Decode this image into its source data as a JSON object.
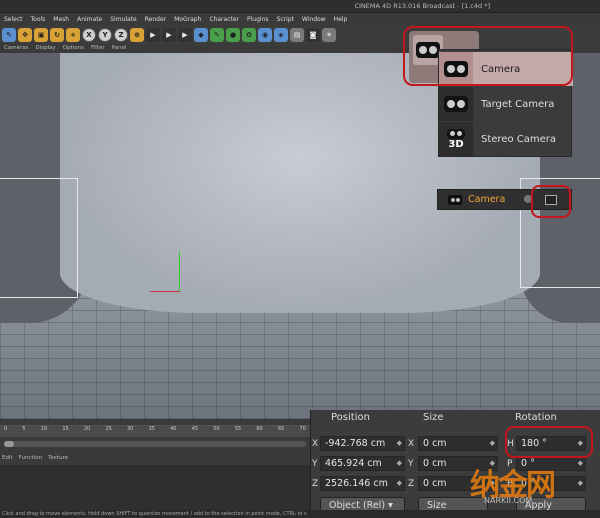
{
  "window": {
    "title": "CINEMA 4D R13.016 Broadcast - [1.c4d *]"
  },
  "menubar": [
    "Select",
    "Tools",
    "Mesh",
    "Animate",
    "Simulate",
    "Render",
    "MoGraph",
    "Character",
    "Plugins",
    "Script",
    "Window",
    "Help"
  ],
  "viewmenu": [
    "Cameras",
    "Display",
    "Options",
    "Filter",
    "Panel"
  ],
  "camera_menu": {
    "items": [
      {
        "label": "Camera",
        "icon": "camera-icon",
        "highlighted": true
      },
      {
        "label": "Target Camera",
        "icon": "target-camera-icon"
      },
      {
        "label": "Stereo Camera",
        "icon": "stereo-camera-icon",
        "badge": "3D"
      }
    ]
  },
  "object_manager": {
    "object_name": "Camera",
    "tag_icon": "target-tag-icon"
  },
  "timeline": {
    "ticks": [
      "0",
      "5",
      "10",
      "15",
      "20",
      "25",
      "30",
      "35",
      "40",
      "45",
      "50",
      "55",
      "60",
      "65",
      "70"
    ]
  },
  "material_menu": [
    "Edit",
    "Function",
    "Texture"
  ],
  "coordinates": {
    "headers": {
      "position": "Position",
      "size": "Size",
      "rotation": "Rotation"
    },
    "rows": [
      {
        "axis": "X",
        "position": "-942.768 cm",
        "size_axis": "X",
        "size": "0 cm",
        "rot_axis": "H",
        "rotation": "180 °"
      },
      {
        "axis": "Y",
        "position": "465.924 cm",
        "size_axis": "Y",
        "size": "0 cm",
        "rot_axis": "P",
        "rotation": "0 °"
      },
      {
        "axis": "Z",
        "position": "2526.146 cm",
        "size_axis": "Z",
        "size": "0 cm",
        "rot_axis": "B",
        "rotation": "0 °"
      }
    ],
    "mode_button": "Object (Rel)",
    "size_button": "Size",
    "apply_button": "Apply"
  },
  "statusbar": {
    "text": "Click and drag to move elements. Hold down SHIFT to quantize movement / add to the selection in point mode, CTRL to s"
  },
  "watermark": {
    "logo": "纳金网",
    "url": "NARKII.COM"
  },
  "colors": {
    "accent_red": "#c4161c",
    "object_orange": "#f0a53a"
  }
}
